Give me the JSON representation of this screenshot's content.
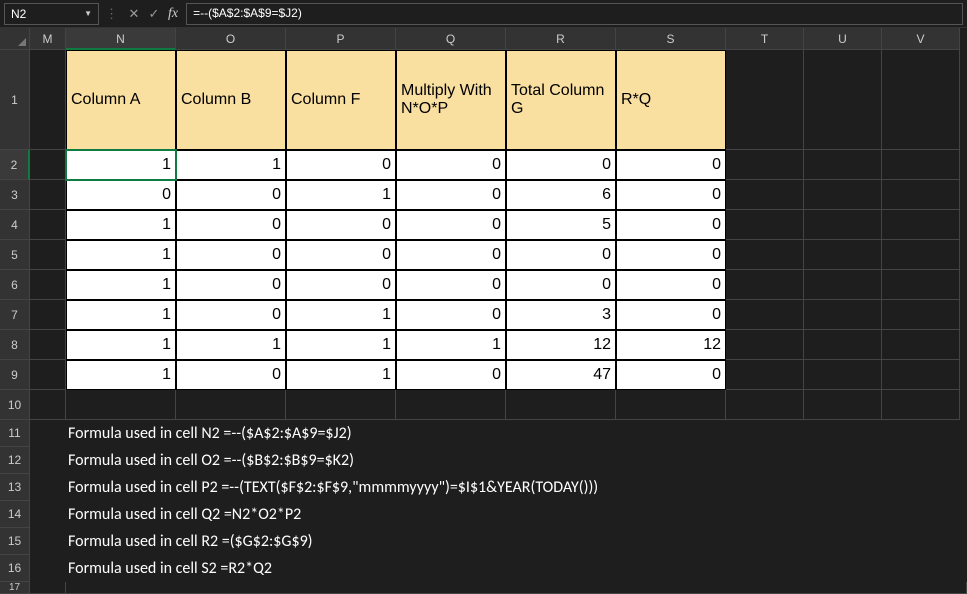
{
  "nameBox": "N2",
  "formulaInput": "=--($A$2:$A$9=$J2)",
  "fxLabel": "fx",
  "cancelGlyph": "✕",
  "acceptGlyph": "✓",
  "columns": [
    "M",
    "N",
    "O",
    "P",
    "Q",
    "R",
    "S",
    "T",
    "U",
    "V"
  ],
  "activeCol": "N",
  "activeRow": 2,
  "headers": {
    "N": "Column A",
    "O": "Column B",
    "P": "Column F",
    "Q": "Multiply With N*O*P",
    "R": "Total Column G",
    "S": "R*Q"
  },
  "dataRows": [
    {
      "N": "1",
      "O": "1",
      "P": "0",
      "Q": "0",
      "R": "0",
      "S": "0"
    },
    {
      "N": "0",
      "O": "0",
      "P": "1",
      "Q": "0",
      "R": "6",
      "S": "0"
    },
    {
      "N": "1",
      "O": "0",
      "P": "0",
      "Q": "0",
      "R": "5",
      "S": "0"
    },
    {
      "N": "1",
      "O": "0",
      "P": "0",
      "Q": "0",
      "R": "0",
      "S": "0"
    },
    {
      "N": "1",
      "O": "0",
      "P": "0",
      "Q": "0",
      "R": "0",
      "S": "0"
    },
    {
      "N": "1",
      "O": "0",
      "P": "1",
      "Q": "0",
      "R": "3",
      "S": "0"
    },
    {
      "N": "1",
      "O": "1",
      "P": "1",
      "Q": "1",
      "R": "12",
      "S": "12"
    },
    {
      "N": "1",
      "O": "0",
      "P": "1",
      "Q": "0",
      "R": "47",
      "S": "0"
    }
  ],
  "formulas": [
    "Formula used in cell N2 =--($A$2:$A$9=$J2)",
    "Formula used in cell O2 =--($B$2:$B$9=$K2)",
    "Formula used in cell P2 =--(TEXT($F$2:$F$9,\"mmmmyyyy\")=$I$1&YEAR(TODAY()))",
    "Formula used in cell Q2 =N2*O2*P2",
    "Formula used in cell R2 =($G$2:$G$9)",
    "Formula used in cell S2 =R2*Q2"
  ],
  "rowNumbers": [
    "1",
    "2",
    "3",
    "4",
    "5",
    "6",
    "7",
    "8",
    "9",
    "10",
    "11",
    "12",
    "13",
    "14",
    "15",
    "16",
    "17"
  ]
}
